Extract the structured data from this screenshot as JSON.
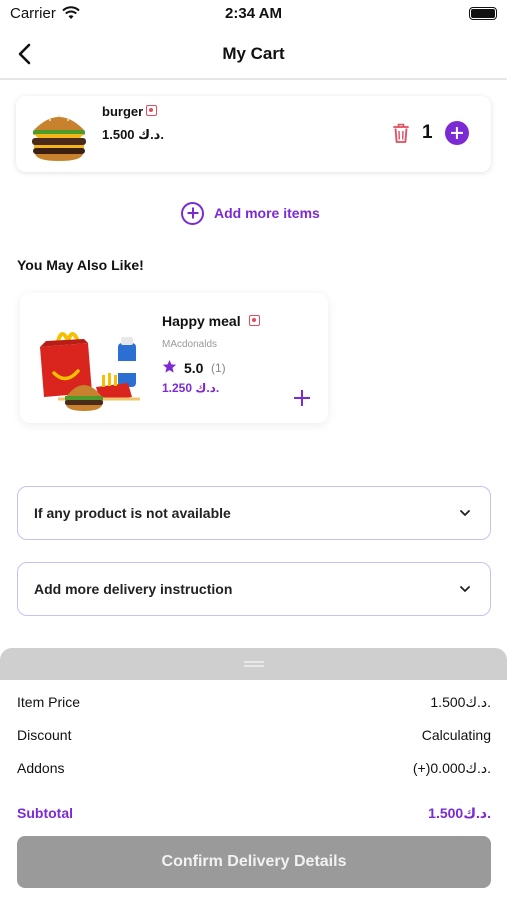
{
  "status_bar": {
    "carrier": "Carrier",
    "time": "2:34 AM"
  },
  "nav": {
    "title": "My Cart"
  },
  "cart_items": [
    {
      "name": "burger",
      "price": "1.500 د.ك.",
      "quantity": "1"
    }
  ],
  "add_more_label": "Add more items",
  "suggestions": {
    "title": "You May Also Like!",
    "items": [
      {
        "name": "Happy meal",
        "vendor": "MAcdonalds",
        "rating": "5.0",
        "rating_count": "(1)",
        "price": "1.250 د.ك."
      }
    ]
  },
  "dropdowns": [
    {
      "label": "If any product is not available"
    },
    {
      "label": "Add more delivery instruction"
    }
  ],
  "summary": {
    "item_price_label": "Item Price",
    "item_price_value": "1.500د.ك.",
    "discount_label": "Discount",
    "discount_value": "Calculating",
    "addons_label": "Addons",
    "addons_value": "(+)0.000د.ك.",
    "subtotal_label": "Subtotal",
    "subtotal_value": "1.500د.ك."
  },
  "confirm_button_label": "Confirm Delivery Details",
  "colors": {
    "accent": "#7b2ad4",
    "button_disabled": "#9a9a9a",
    "veg_marker": "#e34b5f"
  }
}
